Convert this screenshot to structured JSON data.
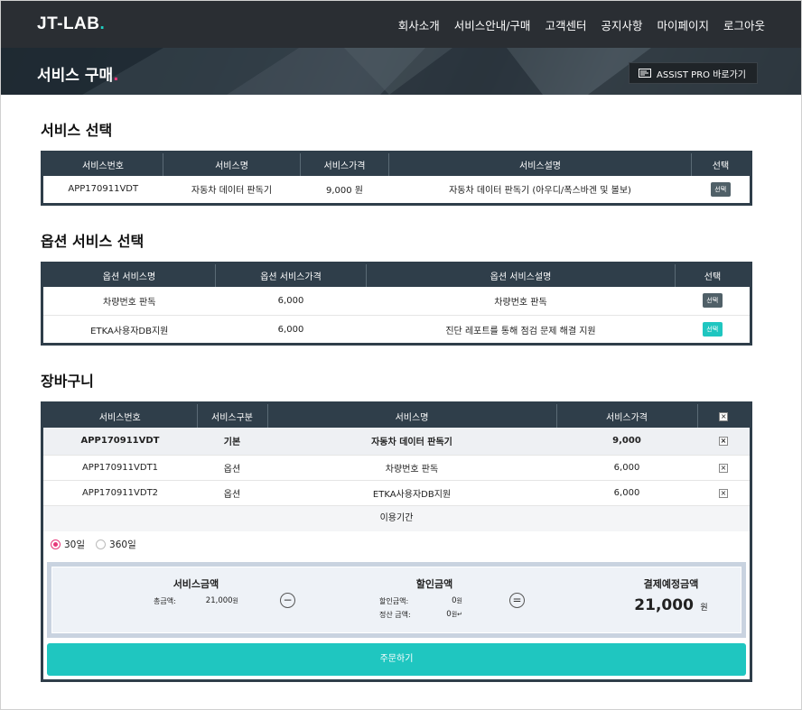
{
  "header": {
    "logo": "JT-LAB",
    "logo_dot": ".",
    "menu": [
      "회사소개",
      "서비스안내/구매",
      "고객센터",
      "공지사항",
      "마이페이지",
      "로그아웃"
    ]
  },
  "banner": {
    "title": "서비스 구매",
    "title_dot": ".",
    "assist_button": "ASSIST PRO 바로가기"
  },
  "service": {
    "heading": "서비스 선택",
    "columns": [
      "서비스번호",
      "서비스명",
      "서비스가격",
      "서비스설명",
      "선택"
    ],
    "rows": [
      {
        "no": "APP170911VDT",
        "name": "자동차 데이터 판독기",
        "price": "9,000 원",
        "desc": "자동차 데이터 판독기 (아우디/폭스바겐 및 볼보)",
        "select": "선택"
      }
    ]
  },
  "options": {
    "heading": "옵션 서비스 선택",
    "columns": [
      "옵션 서비스명",
      "옵션 서비스가격",
      "옵션 서비스설명",
      "선택"
    ],
    "rows": [
      {
        "name": "차량번호 판독",
        "price": "6,000",
        "desc": "차량번호 판독",
        "select": "선택"
      },
      {
        "name": "ETKA사용자DB지원",
        "price": "6,000",
        "desc": "진단 레포트를 통해 점검 문제 해결 지원",
        "select": "선택"
      }
    ]
  },
  "cart": {
    "heading": "장바구니",
    "columns": [
      "서비스번호",
      "서비스구분",
      "서비스명",
      "서비스가격"
    ],
    "rows": [
      {
        "no": "APP170911VDT",
        "type": "기본",
        "name": "자동차 데이터 판독기",
        "price": "9,000"
      },
      {
        "no": "APP170911VDT1",
        "type": "옵션",
        "name": "차량번호 판독",
        "price": "6,000"
      },
      {
        "no": "APP170911VDT2",
        "type": "옵션",
        "name": "ETKA사용자DB지원",
        "price": "6,000"
      }
    ],
    "period_label": "이용기간",
    "period_options": [
      "30일",
      "360일"
    ],
    "period_selected": "30일"
  },
  "summary": {
    "service_title": "서비스금액",
    "total_label": "총금액:",
    "total_value": "21,000",
    "won_small": "원",
    "discount_title": "할인금액",
    "discount_label": "할인금액:",
    "discount_value": "0",
    "settle_label": "정산 금액:",
    "settle_value": "0",
    "settle_suffix": "원↵",
    "final_title": "결제예정금액",
    "final_value": "21,000",
    "final_unit": "원",
    "minus_symbol": "−",
    "equals_symbol": "="
  },
  "order_button": "주문하기",
  "colors": {
    "accent": "#1fc6c0",
    "brand_dot": "#e6387a",
    "dark": "#2f3e4a"
  }
}
